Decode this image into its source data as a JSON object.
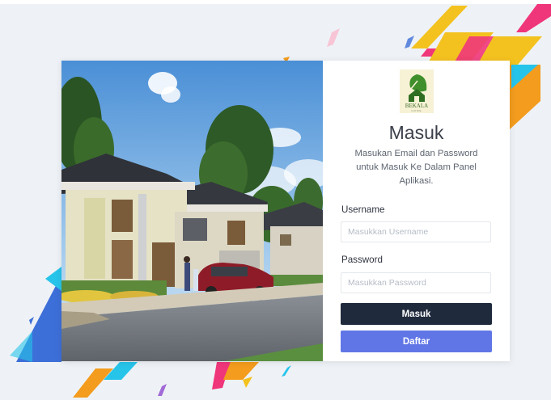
{
  "brand": {
    "logo_text": "BEKALA",
    "logo_subtext": "HOME"
  },
  "login": {
    "title": "Masuk",
    "subtitle": "Masukan Email dan Password untuk Masuk Ke Dalam Panel Aplikasi.",
    "username_label": "Username",
    "username_placeholder": "Masukkan Username",
    "username_value": "",
    "password_label": "Password",
    "password_placeholder": "Masukkan Password",
    "password_value": "",
    "submit_label": "Masuk",
    "register_label": "Daftar"
  },
  "colors": {
    "background": "#eef2f6",
    "primary_button": "#1f2b3d",
    "secondary_button": "#6176e6",
    "logo_green": "#3f8f2c",
    "accent_yellow": "#f4c21f",
    "accent_pink": "#f0367a",
    "accent_cyan": "#27c4ea",
    "accent_blue": "#3d6fd8"
  },
  "icons": {
    "logo": "leaf-house-logo"
  }
}
